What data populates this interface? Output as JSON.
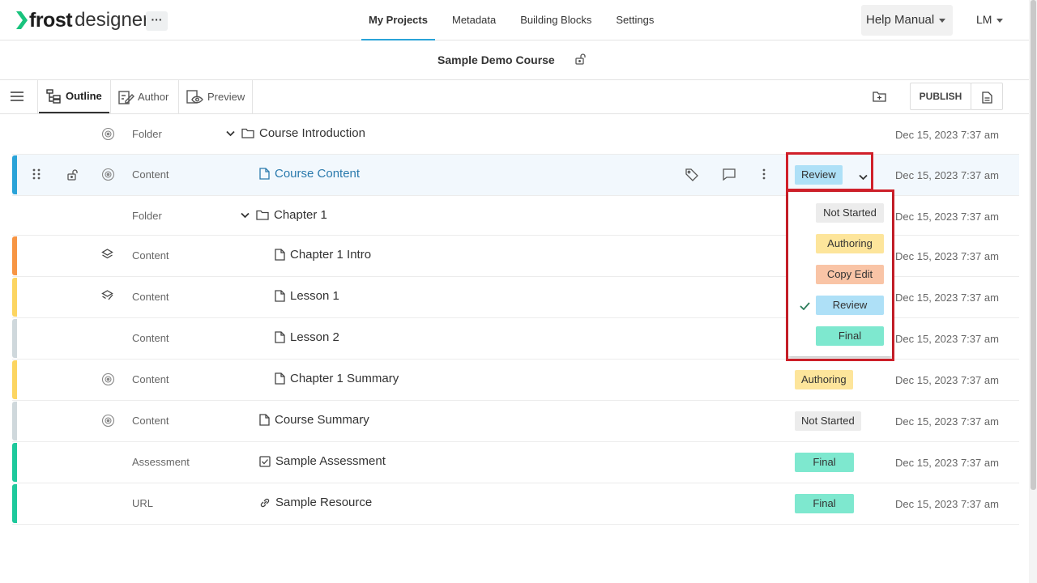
{
  "app": {
    "logo_bold": "frost",
    "logo_light": "designer",
    "more_label": "···"
  },
  "nav": {
    "items": [
      "My Projects",
      "Metadata",
      "Building Blocks",
      "Settings"
    ],
    "active": "My Projects"
  },
  "help": {
    "label": "Help Manual"
  },
  "user": {
    "initials": "LM"
  },
  "course": {
    "title": "Sample Demo Course"
  },
  "toolbar": {
    "tabs": [
      {
        "label": "Outline",
        "active": true
      },
      {
        "label": "Author",
        "active": false
      },
      {
        "label": "Preview",
        "active": false
      }
    ],
    "publish_label": "PUBLISH"
  },
  "colors": {
    "accent": "#2aa3d8",
    "not_started": "#ececec",
    "authoring": "#fde59b",
    "copy_edit": "#f9c4a6",
    "review": "#aee0f7",
    "final": "#7ee8cf",
    "highlight": "#d0202a"
  },
  "rows": [
    {
      "type": "Folder",
      "name": "Course Introduction",
      "kind": "folder",
      "status": "",
      "date": "Dec 15, 2023 7:37 am",
      "bar": "",
      "status_icon": "gear-icon"
    },
    {
      "type": "Content",
      "name": "Course Content",
      "kind": "page",
      "status": "Review",
      "date": "Dec 15, 2023 7:37 am",
      "bar": "#2aa3d8",
      "status_icon": "gear-icon",
      "selected": true
    },
    {
      "type": "Folder",
      "name": "Chapter 1",
      "kind": "folder",
      "status": "",
      "date": "Dec 15, 2023 7:37 am",
      "bar": "",
      "status_icon": ""
    },
    {
      "type": "Content",
      "name": "Chapter 1 Intro",
      "kind": "page",
      "status": "",
      "date": "Dec 15, 2023 7:37 am",
      "bar": "#f79544",
      "status_icon": "layers-icon"
    },
    {
      "type": "Content",
      "name": "Lesson 1",
      "kind": "page",
      "status": "",
      "date": "Dec 15, 2023 7:37 am",
      "bar": "#fcd561",
      "status_icon": "layers-check-icon"
    },
    {
      "type": "Content",
      "name": "Lesson 2",
      "kind": "page",
      "status": "",
      "date": "Dec 15, 2023 7:37 am",
      "bar": "#cfd8dc",
      "status_icon": ""
    },
    {
      "type": "Content",
      "name": "Chapter 1 Summary",
      "kind": "page",
      "status": "Authoring",
      "date": "Dec 15, 2023 7:37 am",
      "bar": "#fcd561",
      "status_icon": "gear-icon"
    },
    {
      "type": "Content",
      "name": "Course Summary",
      "kind": "page",
      "status": "Not Started",
      "date": "Dec 15, 2023 7:37 am",
      "bar": "#cfd8dc",
      "status_icon": "gear-icon"
    },
    {
      "type": "Assessment",
      "name": "Sample Assessment",
      "kind": "assessment",
      "status": "Final",
      "date": "Dec 15, 2023 7:37 am",
      "bar": "#1ec99c",
      "status_icon": ""
    },
    {
      "type": "URL",
      "name": "Sample Resource",
      "kind": "url",
      "status": "Final",
      "date": "Dec 15, 2023 7:37 am",
      "bar": "#1ec99c",
      "status_icon": ""
    }
  ],
  "status_dropdown": {
    "options": [
      "Not Started",
      "Authoring",
      "Copy Edit",
      "Review",
      "Final"
    ],
    "selected": "Review"
  }
}
